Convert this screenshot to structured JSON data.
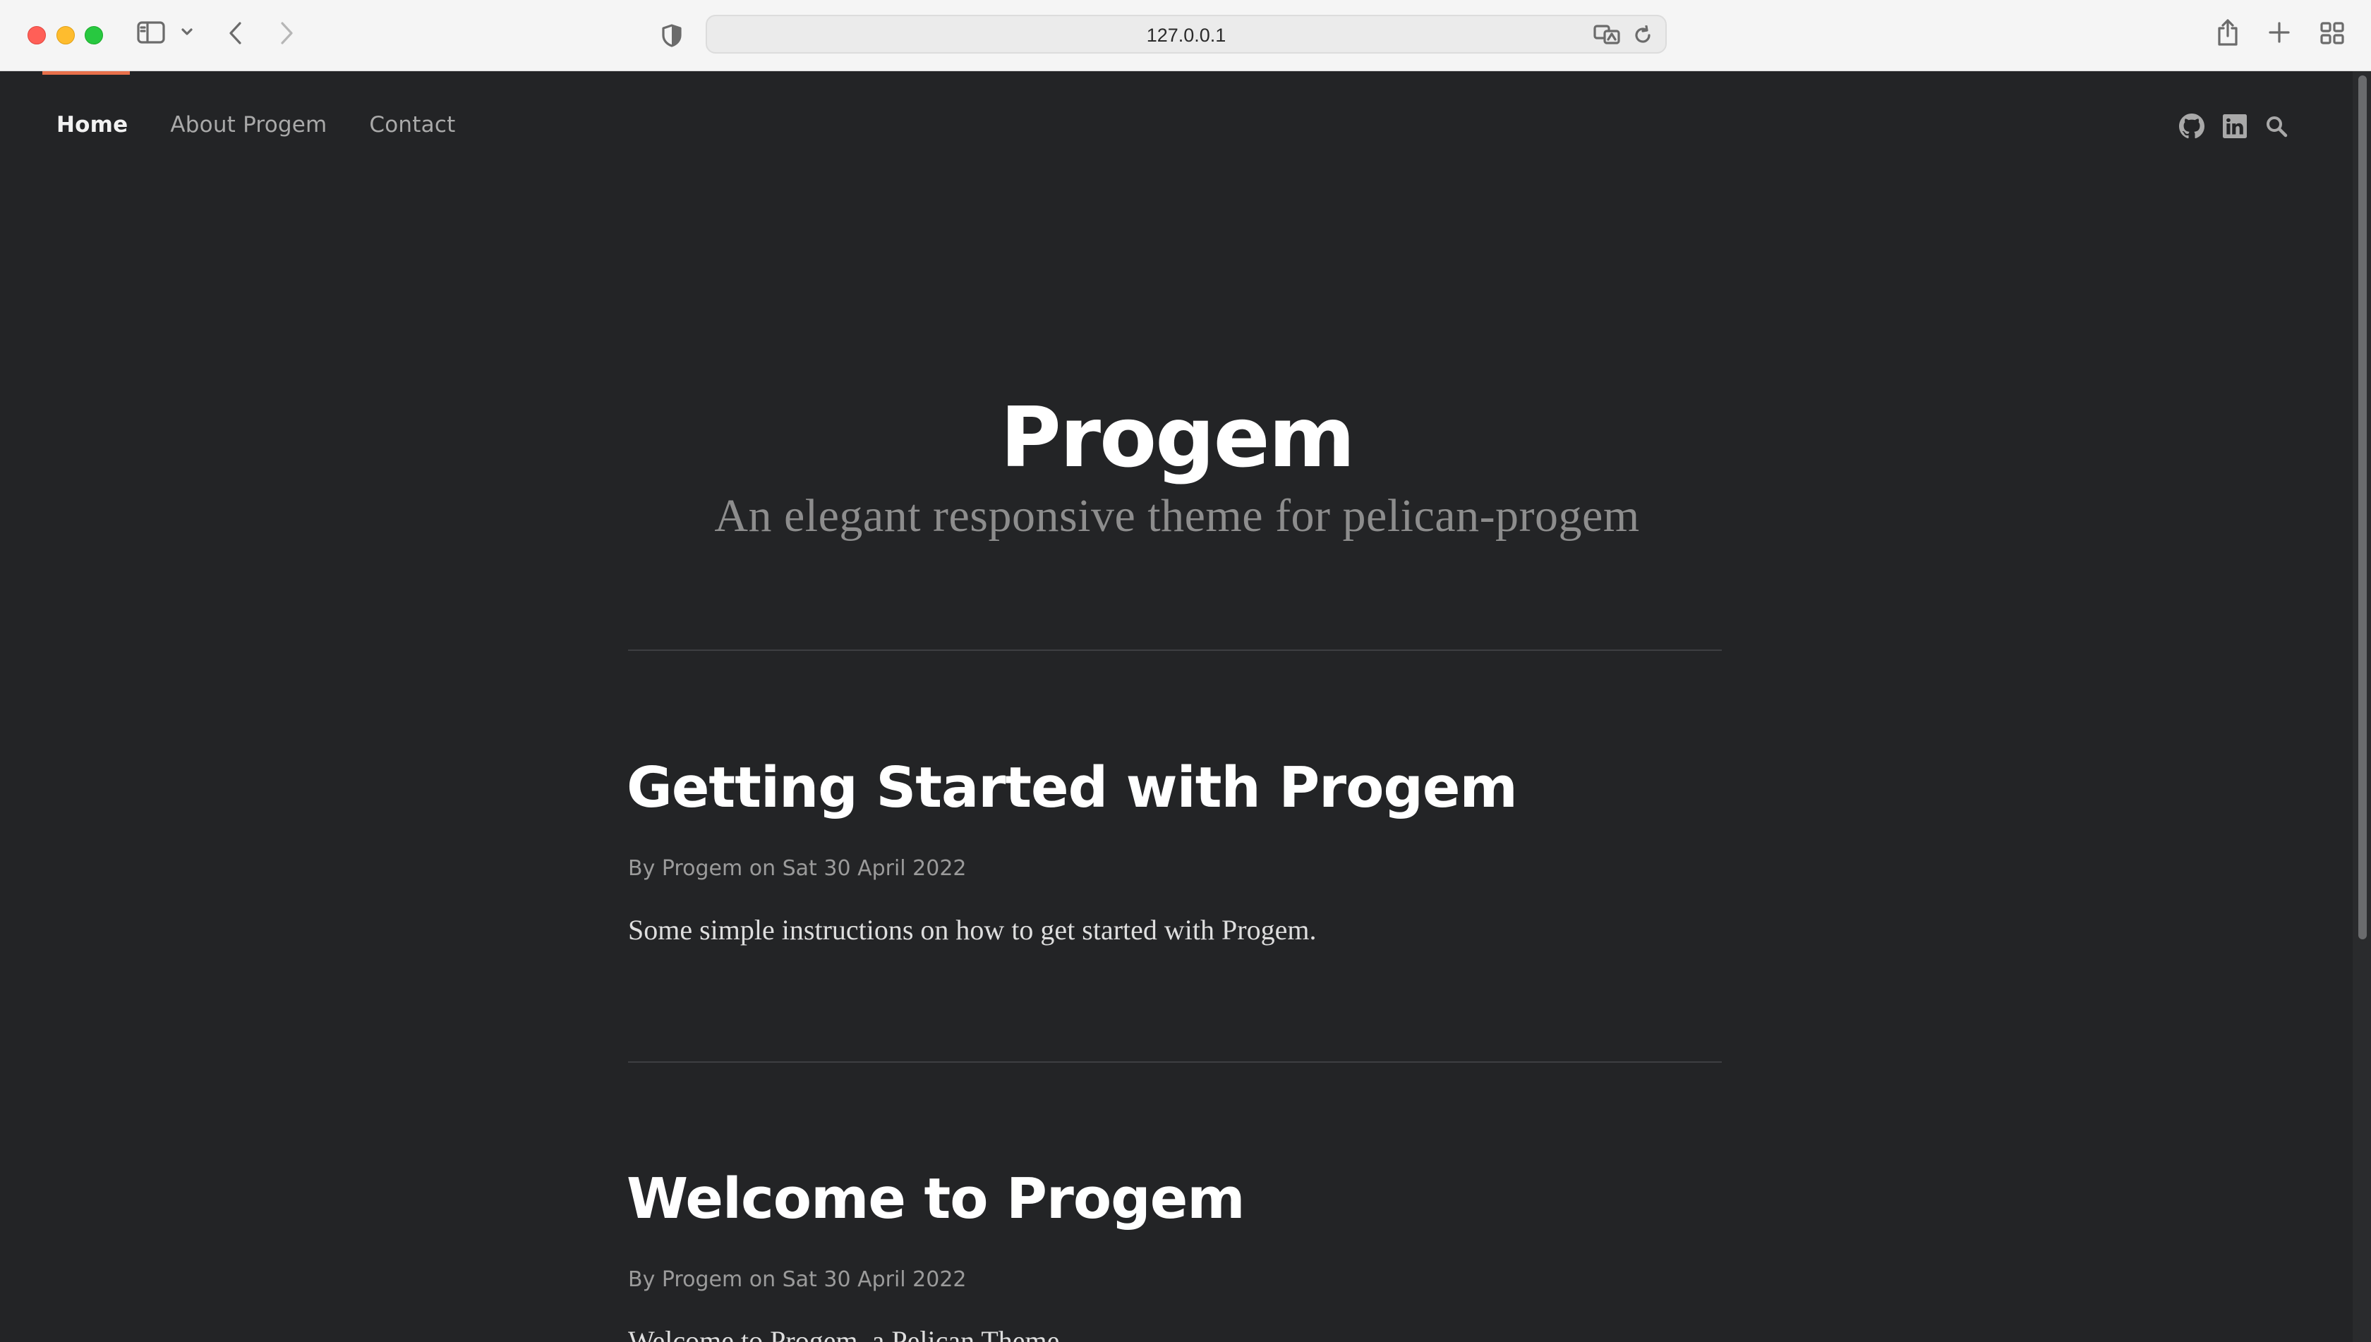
{
  "browser": {
    "url": "127.0.0.1"
  },
  "nav": {
    "items": [
      {
        "label": "Home",
        "active": true
      },
      {
        "label": "About Progem",
        "active": false
      },
      {
        "label": "Contact",
        "active": false
      }
    ],
    "social": [
      "github-icon",
      "linkedin-icon",
      "search-icon"
    ]
  },
  "site": {
    "title": "Progem",
    "tagline": "An elegant responsive theme for pelican-progem"
  },
  "posts": [
    {
      "title": "Getting Started with Progem",
      "meta": "By Progem on Sat 30 April 2022",
      "summary": "Some simple instructions on how to get started with Progem."
    },
    {
      "title": "Welcome to Progem",
      "meta": "By Progem on Sat 30 April 2022",
      "summary": "Welcome to Progem, a Pelican Theme"
    }
  ],
  "colors": {
    "background": "#232426",
    "accent": "#e8704b",
    "title": "#ffffff",
    "muted": "#9b9b9b"
  }
}
